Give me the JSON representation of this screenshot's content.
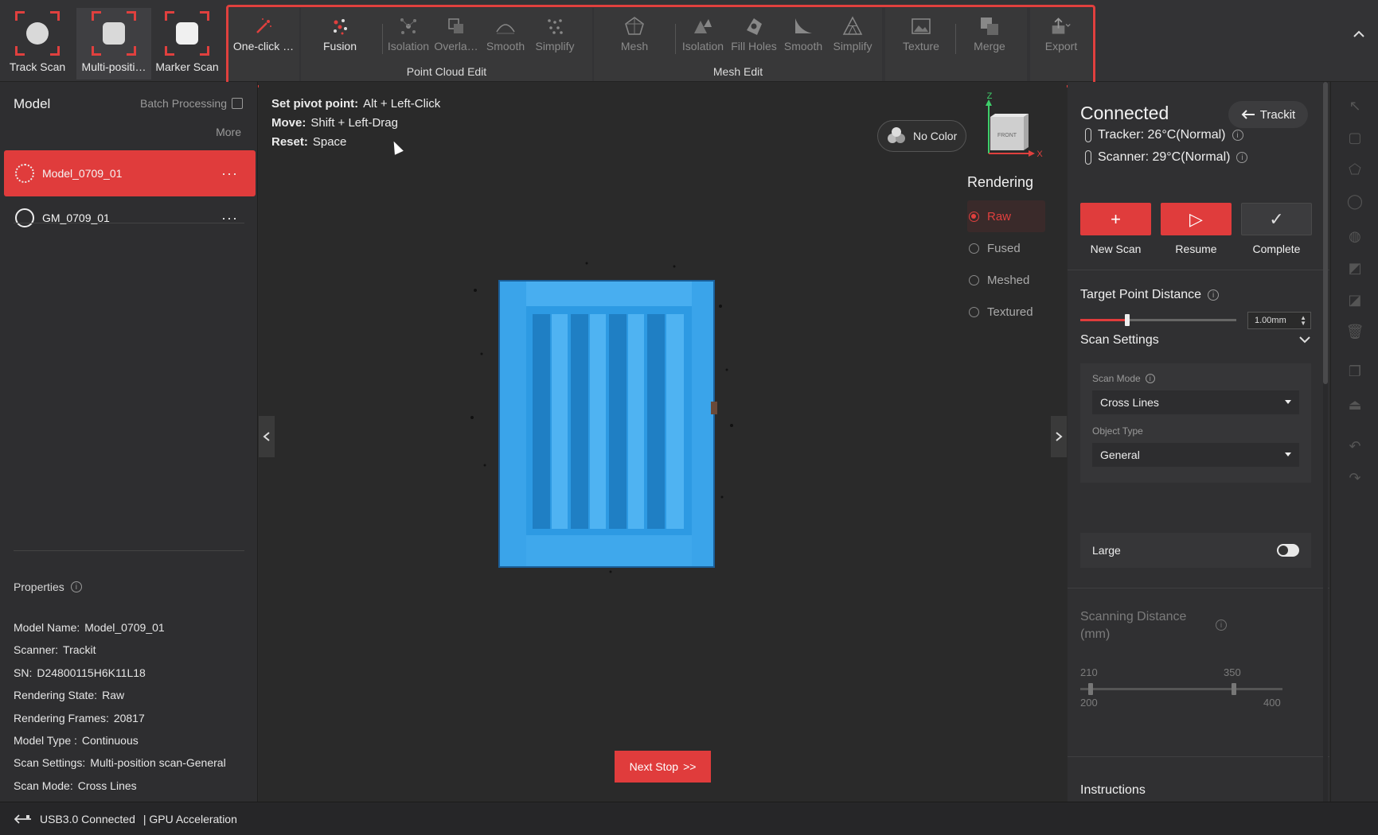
{
  "scan_modes": [
    {
      "label": "Track Scan"
    },
    {
      "label": "Multi-positi…"
    },
    {
      "label": "Marker Scan"
    }
  ],
  "point_cloud_edit": {
    "title": "Point Cloud Edit",
    "tools": [
      {
        "label": "One-click …"
      },
      {
        "label": "Fusion"
      },
      {
        "label": "Isolation"
      },
      {
        "label": "Overla…"
      },
      {
        "label": "Smooth"
      },
      {
        "label": "Simplify"
      }
    ]
  },
  "mesh_edit": {
    "title": "Mesh Edit",
    "tools": [
      {
        "label": "Mesh"
      },
      {
        "label": "Isolation"
      },
      {
        "label": "Fill Holes"
      },
      {
        "label": "Smooth"
      },
      {
        "label": "Simplify"
      }
    ]
  },
  "extra_tools": [
    {
      "label": "Texture"
    },
    {
      "label": "Merge"
    },
    {
      "label": "Export"
    }
  ],
  "left_panel": {
    "title": "Model",
    "batch_label": "Batch Processing",
    "more_label": "More",
    "models": [
      {
        "name": "Model_0709_01",
        "dots": "···"
      },
      {
        "name": "GM_0709_01",
        "dots": "···"
      }
    ],
    "properties_title": "Properties",
    "properties": [
      {
        "key": "Model Name:",
        "value": "Model_0709_01"
      },
      {
        "key": "Scanner:",
        "value": "Trackit"
      },
      {
        "key": "SN:",
        "value": "D24800115H6K11L18"
      },
      {
        "key": "Rendering State:",
        "value": "Raw"
      },
      {
        "key": "Rendering Frames:",
        "value": "20817"
      },
      {
        "key": "Model Type :",
        "value": "Continuous"
      },
      {
        "key": "Scan Settings:",
        "value": "Multi-position scan-General"
      },
      {
        "key": "Scan Mode:",
        "value": "Cross Lines"
      }
    ]
  },
  "viewport": {
    "hints": [
      {
        "key": "Set pivot point:",
        "value": "Alt + Left-Click"
      },
      {
        "key": "Move:",
        "value": "Shift + Left-Drag"
      },
      {
        "key": "Reset:",
        "value": "Space"
      }
    ],
    "color_toggle": "No Color",
    "axis": {
      "z": "Z",
      "x": "X",
      "face": "FRONT"
    },
    "rendering_title": "Rendering",
    "rendering_options": [
      "Raw",
      "Fused",
      "Meshed",
      "Textured"
    ],
    "rendering_selected": "Raw",
    "next_stop_label": "Next Stop",
    "next_stop_arrows": ">>"
  },
  "right_panel": {
    "status": "Connected",
    "device_button": "Trackit",
    "tracker_temp": "Tracker: 26°C(Normal)",
    "scanner_temp": "Scanner: 29°C(Normal)",
    "actions": [
      {
        "label": "New Scan",
        "glyph": "+"
      },
      {
        "label": "Resume",
        "glyph": "▷"
      },
      {
        "label": "Complete",
        "glyph": "✓"
      }
    ],
    "target_point_distance": {
      "label": "Target Point Distance",
      "value": "1.00mm",
      "slider_fraction": 0.3
    },
    "scan_settings": {
      "title": "Scan Settings",
      "scan_mode_label": "Scan Mode",
      "scan_mode_value": "Cross Lines",
      "object_type_label": "Object Type",
      "object_type_value": "General",
      "large_label": "Large"
    },
    "scanning_distance": {
      "label_line1": "Scanning Distance",
      "label_line2": "(mm)",
      "upper_left": "210",
      "upper_right": "350",
      "lower_left": "200",
      "lower_right": "400"
    },
    "instructions_label": "Instructions"
  },
  "status_bar": {
    "usb": "USB3.0 Connected",
    "gpu": "| GPU Acceleration"
  },
  "colors": {
    "accent": "#e03c3c",
    "scan_blue": "#2f9be0",
    "panel": "#2e2e30"
  }
}
